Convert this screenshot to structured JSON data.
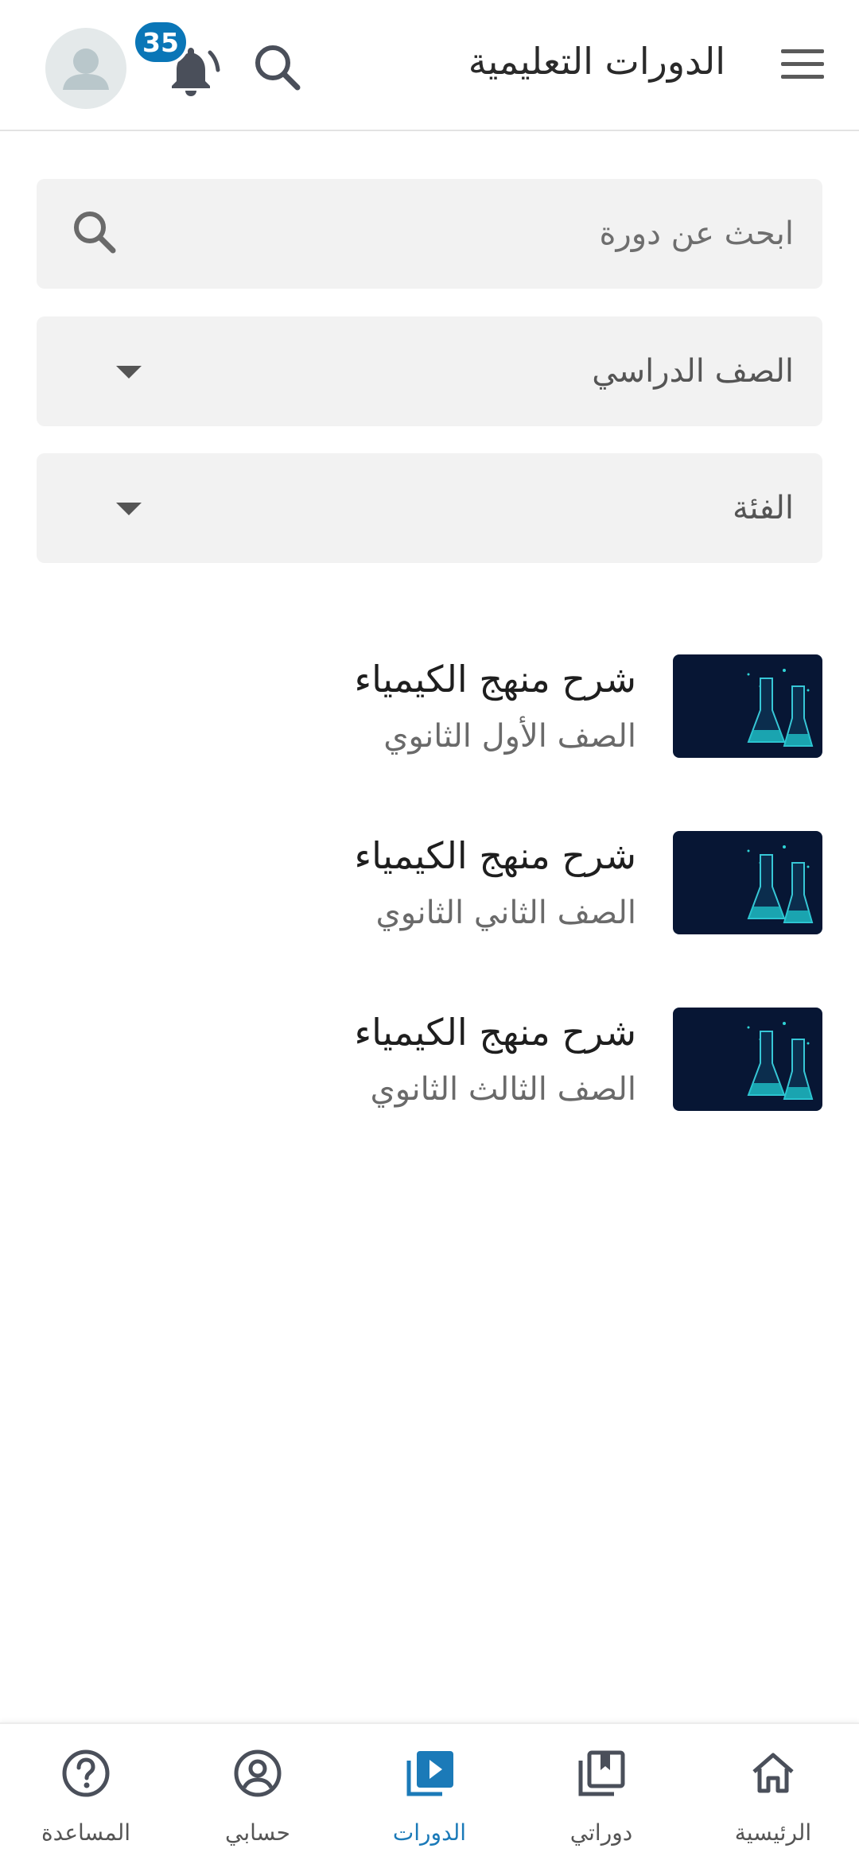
{
  "header": {
    "title": "الدورات التعليمية",
    "notification_count": "35"
  },
  "filters": {
    "search_placeholder": "ابحث عن دورة",
    "grade_label": "الصف الدراسي",
    "category_label": "الفئة"
  },
  "courses": [
    {
      "title": "شرح منهج الكيمياء",
      "subtitle": "الصف الأول الثانوي"
    },
    {
      "title": "شرح منهج الكيمياء",
      "subtitle": "الصف الثاني الثانوي"
    },
    {
      "title": "شرح منهج الكيمياء",
      "subtitle": "الصف الثالث الثانوي"
    }
  ],
  "bottom_nav": {
    "items": [
      {
        "label": "الرئيسية",
        "icon": "home-icon",
        "active": false
      },
      {
        "label": "دوراتي",
        "icon": "library-icon",
        "active": false
      },
      {
        "label": "الدورات",
        "icon": "play-library-icon",
        "active": true
      },
      {
        "label": "حسابي",
        "icon": "account-icon",
        "active": false
      },
      {
        "label": "المساعدة",
        "icon": "help-icon",
        "active": false
      }
    ]
  },
  "colors": {
    "accent": "#1b7ab8",
    "badge": "#0a76b7",
    "icon_gray": "#555555",
    "field_bg": "#f2f2f2"
  }
}
